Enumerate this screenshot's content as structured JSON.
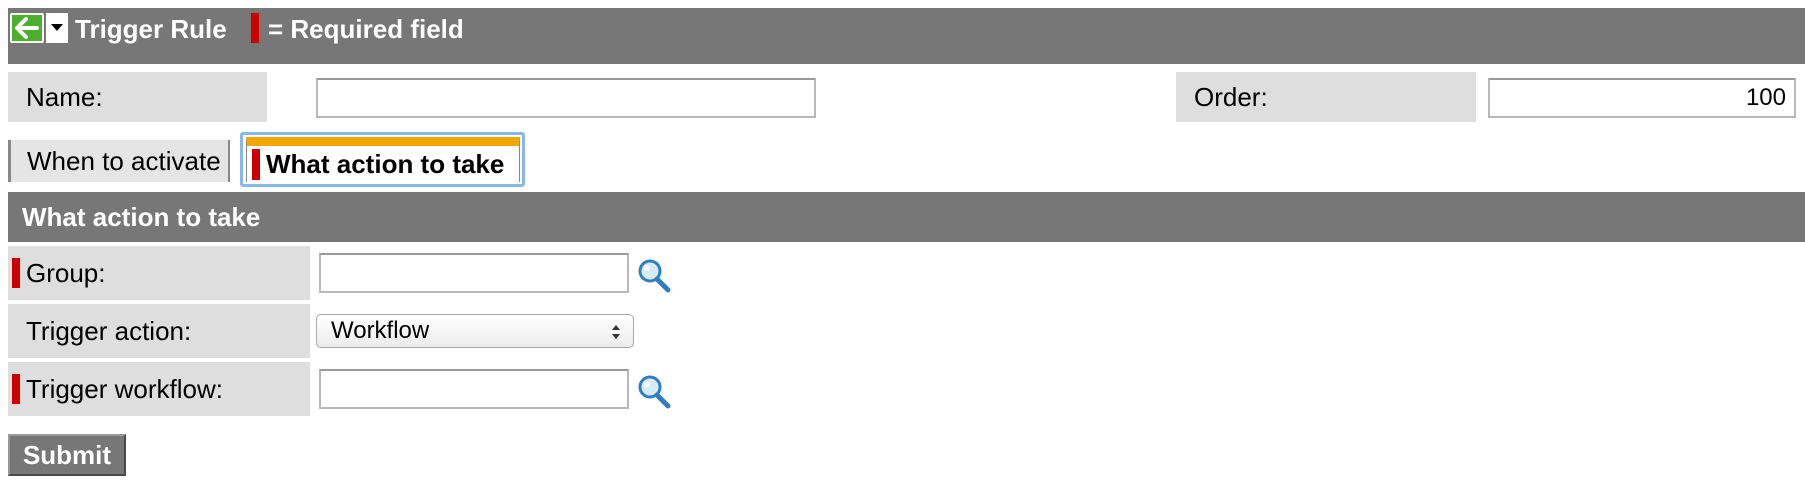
{
  "header": {
    "title": "Trigger Rule",
    "required_legend": "= Required field",
    "back_icon": "back-arrow-icon",
    "menu_icon": "caret-down-icon"
  },
  "fields": {
    "name": {
      "label": "Name:",
      "value": ""
    },
    "order": {
      "label": "Order:",
      "value": "100"
    }
  },
  "tabs": [
    {
      "label": "When to activate",
      "active": false
    },
    {
      "label": "What action to take",
      "active": true,
      "required": true
    }
  ],
  "section": {
    "title": "What action to take",
    "group": {
      "label": "Group:",
      "value": "",
      "required": true
    },
    "trigger_action": {
      "label": "Trigger action:",
      "selected": "Workflow"
    },
    "trigger_workflow": {
      "label": "Trigger workflow:",
      "value": "",
      "required": true
    }
  },
  "actions": {
    "submit_label": "Submit"
  },
  "colors": {
    "header_bg": "#777777",
    "label_bg": "#dedede",
    "required": "#cc0000",
    "active_tab_accent": "#f5a800",
    "back_button": "#4caf2f"
  }
}
